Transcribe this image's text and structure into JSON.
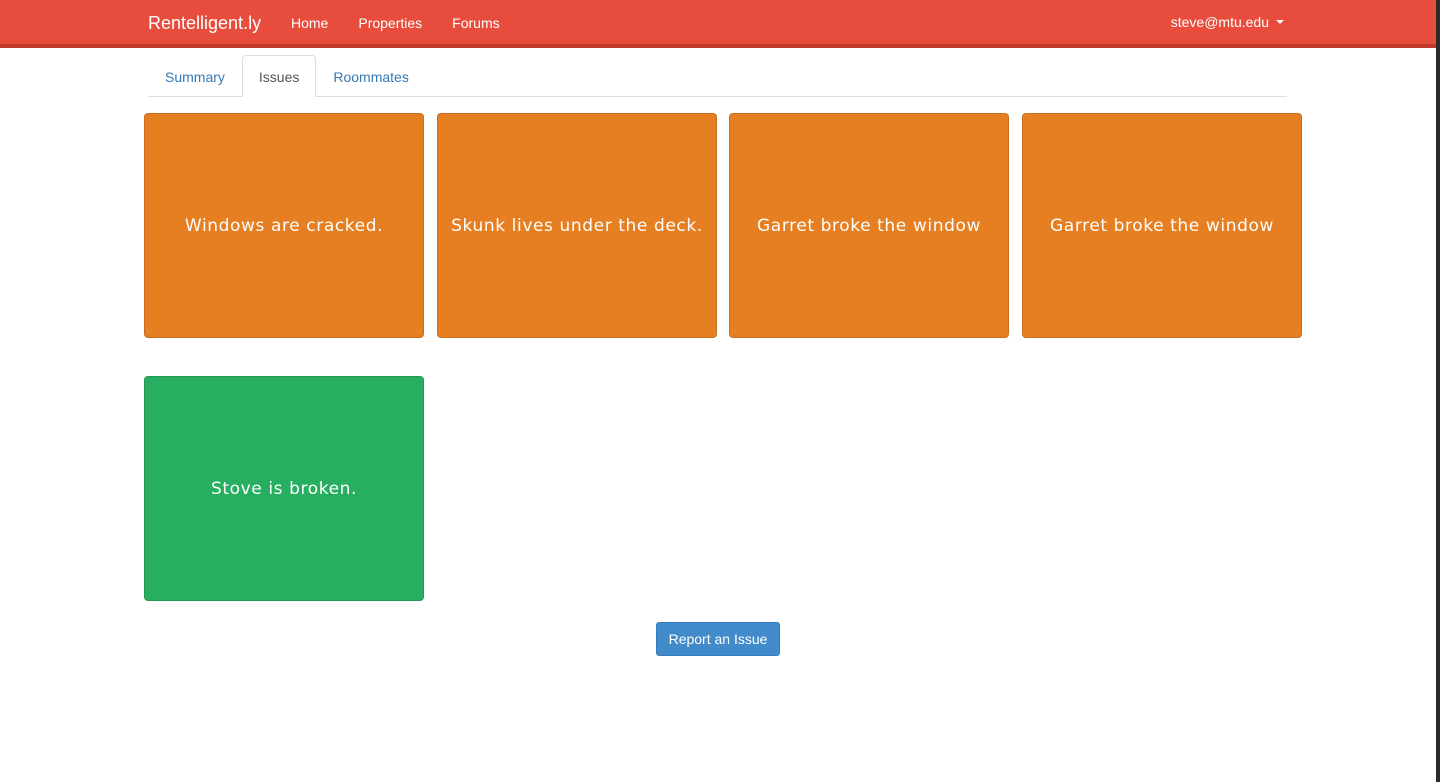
{
  "navbar": {
    "brand": "Rentelligent.ly",
    "links": [
      "Home",
      "Properties",
      "Forums"
    ],
    "user": "steve@mtu.edu",
    "color": "#e74c3c"
  },
  "tabs": [
    {
      "label": "Summary",
      "active": false
    },
    {
      "label": "Issues",
      "active": true
    },
    {
      "label": "Roommates",
      "active": false
    }
  ],
  "issues": [
    {
      "text": "Windows are cracked.",
      "color": "#e67e22"
    },
    {
      "text": "Skunk lives under the deck.",
      "color": "#e67e22"
    },
    {
      "text": "Garret broke the window",
      "color": "#e67e22"
    },
    {
      "text": "Garret broke the window",
      "color": "#e67e22"
    },
    {
      "text": "Stove is broken.",
      "color": "#27ae60"
    }
  ],
  "actions": {
    "report_label": "Report an Issue"
  }
}
